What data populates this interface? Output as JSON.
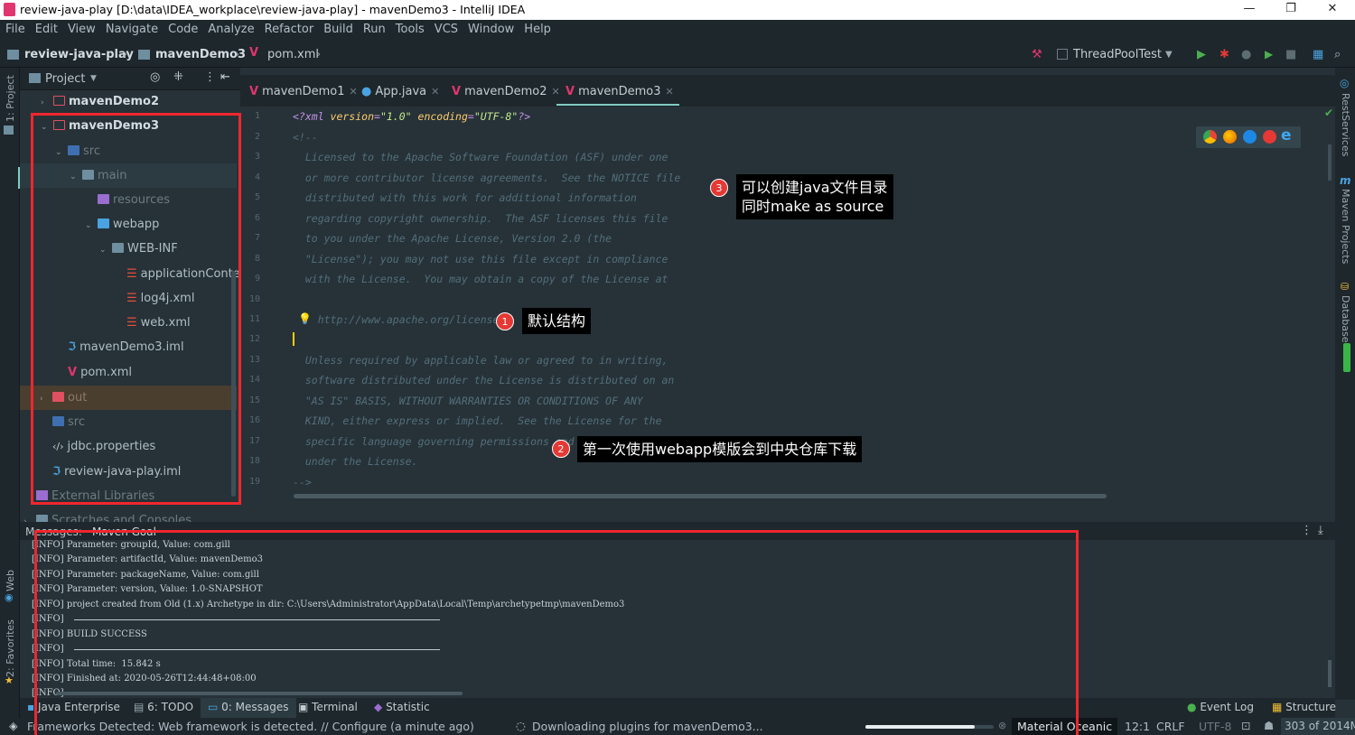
{
  "window": {
    "title": "review-java-play [D:\\data\\IDEA_workplace\\review-java-play] - mavenDemo3 - IntelliJ IDEA",
    "minimize": "—",
    "restore": "❐",
    "close": "✕"
  },
  "menu": [
    "File",
    "Edit",
    "View",
    "Navigate",
    "Code",
    "Analyze",
    "Refactor",
    "Build",
    "Run",
    "Tools",
    "VCS",
    "Window",
    "Help"
  ],
  "breadcrumb": {
    "project": "review-java-play",
    "module": "mavenDemo3",
    "file": "pom.xml"
  },
  "run_config": "ThreadPoolTest",
  "left_strip": {
    "project": "1: Project",
    "web": "Web",
    "favorites": "2: Favorites"
  },
  "right_strip": {
    "rest": "RestServices",
    "maven": "Maven Projects",
    "database": "Database"
  },
  "project_panel": {
    "title": "Project",
    "tree": [
      {
        "label": "mavenDemo2"
      },
      {
        "label": "mavenDemo3"
      },
      {
        "label": "src"
      },
      {
        "label": "main"
      },
      {
        "label": "resources"
      },
      {
        "label": "webapp"
      },
      {
        "label": "WEB-INF"
      },
      {
        "label": "applicationContex"
      },
      {
        "label": "log4j.xml"
      },
      {
        "label": "web.xml"
      },
      {
        "label": "mavenDemo3.iml"
      },
      {
        "label": "pom.xml"
      },
      {
        "label": "out"
      },
      {
        "label": "src"
      },
      {
        "label": "jdbc.properties"
      },
      {
        "label": "review-java-play.iml"
      },
      {
        "label": "External Libraries"
      },
      {
        "label": "Scratches and Consoles"
      }
    ]
  },
  "editor_tabs": [
    "mavenDemo1",
    "App.java",
    "mavenDemo2",
    "mavenDemo3"
  ],
  "line_numbers": [
    "1",
    "2",
    "3",
    "4",
    "5",
    "6",
    "7",
    "8",
    "9",
    "10",
    "11",
    "12",
    "13",
    "14",
    "15",
    "16",
    "17",
    "18",
    "19"
  ],
  "code_lines": [
    "<?xml version=\"1.0\" encoding=\"UTF-8\"?>",
    "<!--",
    "  Licensed to the Apache Software Foundation (ASF) under one",
    "  or more contributor license agreements.  See the NOTICE file",
    "  distributed with this work for additional information",
    "  regarding copyright ownership.  The ASF licenses this file",
    "  to you under the Apache License, Version 2.0 (the",
    "  \"License\"); you may not use this file except in compliance",
    "  with the License.  You may obtain a copy of the License at",
    "",
    "    http://www.apache.org/licenses",
    "",
    "  Unless required by applicable law or agreed to in writing,",
    "  software distributed under the License is distributed on an",
    "  \"AS IS\" BASIS, WITHOUT WARRANTIES OR CONDITIONS OF ANY",
    "  KIND, either express or implied.  See the License for the",
    "  specific language governing permissions and limitations",
    "  under the License.",
    "-->"
  ],
  "messages": {
    "tab_label": "Messages:",
    "tab_name": "Maven Goal",
    "lines": [
      "[INFO] Parameter: groupId, Value: com.gill",
      "[INFO] Parameter: artifactId, Value: mavenDemo3",
      "[INFO] Parameter: packageName, Value: com.gill",
      "[INFO] Parameter: version, Value: 1.0-SNAPSHOT",
      "[INFO] project created from Old (1.x) Archetype in dir: C:\\Users\\Administrator\\AppData\\Local\\Temp\\archetypetmp\\mavenDemo3",
      "[INFO] ",
      "[INFO] BUILD SUCCESS",
      "[INFO] ",
      "[INFO] Total time:  15.842 s",
      "[INFO] Finished at: 2020-05-26T12:44:48+08:00",
      "[INFO] "
    ]
  },
  "bottom_tabs": {
    "java_ee": "Java Enterprise",
    "todo": "6: TODO",
    "messages": "0: Messages",
    "terminal": "Terminal",
    "statistic": "Statistic",
    "event_log": "Event Log",
    "structure": "Structure"
  },
  "status": {
    "left": "Frameworks Detected: Web framework is detected. // Configure (a minute ago)",
    "progress": "Downloading plugins for mavenDemo3...",
    "progress_fraction": 0.85,
    "theme": "Material Oceanic",
    "position": "12:1",
    "line_sep": "CRLF",
    "encoding": "UTF-8",
    "memory": "303 of 2014M"
  },
  "annotations": {
    "a1": {
      "num": "1",
      "text": "默认结构"
    },
    "a2": {
      "num": "2",
      "text": "第一次使用webapp模版会到中央仓库下载"
    },
    "a3": {
      "num": "3",
      "line1": "可以创建java文件目录",
      "line2": "同时make as source"
    }
  },
  "colors": {
    "accent": "#80cbc4",
    "red_box": "#f0262e",
    "bg": "#263238"
  }
}
